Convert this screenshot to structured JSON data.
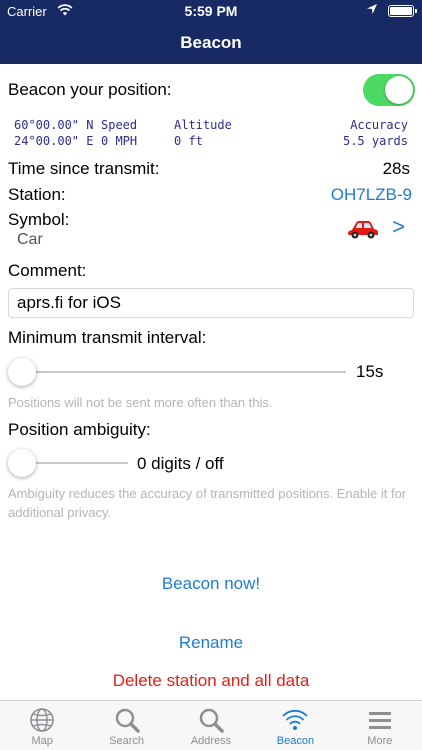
{
  "status_bar": {
    "carrier": "Carrier",
    "time": "5:59 PM"
  },
  "nav": {
    "title": "Beacon"
  },
  "beacon": {
    "label": "Beacon your position:",
    "toggle_on": true,
    "lat": "60°00.00\" N",
    "lon": "24°00.00\" E",
    "speed_label": "Speed",
    "speed_value": "0 MPH",
    "altitude_label": "Altitude",
    "altitude_value": "0 ft",
    "accuracy_label": "Accuracy",
    "accuracy_value": "5.5 yards"
  },
  "time_since": {
    "label": "Time since transmit:",
    "value": "28s"
  },
  "station": {
    "label": "Station:",
    "value": "OH7LZB-9"
  },
  "symbol": {
    "label": "Symbol:",
    "value": "Car",
    "chevron": ">"
  },
  "comment": {
    "label": "Comment:",
    "value": "aprs.fi for iOS"
  },
  "interval": {
    "label": "Minimum transmit interval:",
    "value": "15s",
    "slider_fraction": 0,
    "hint": "Positions will not be sent more often than this."
  },
  "ambiguity": {
    "label": "Position ambiguity:",
    "value": "0 digits / off",
    "slider_fraction": 0,
    "hint": "Ambiguity reduces the accuracy of transmitted positions. Enable it for additional privacy."
  },
  "actions": {
    "beacon_now": "Beacon now!",
    "rename": "Rename",
    "delete": "Delete station and all data"
  },
  "tabs": [
    {
      "label": "Map",
      "icon": "globe-icon"
    },
    {
      "label": "Search",
      "icon": "search-icon"
    },
    {
      "label": "Address",
      "icon": "magnifier-icon"
    },
    {
      "label": "Beacon",
      "icon": "wifi-icon",
      "active": true
    },
    {
      "label": "More",
      "icon": "list-icon"
    }
  ],
  "colors": {
    "nav_bar": "#172a63",
    "toggle_on": "#4cd964",
    "accent": "#1f7bd3",
    "destructive": "#e0201b"
  }
}
